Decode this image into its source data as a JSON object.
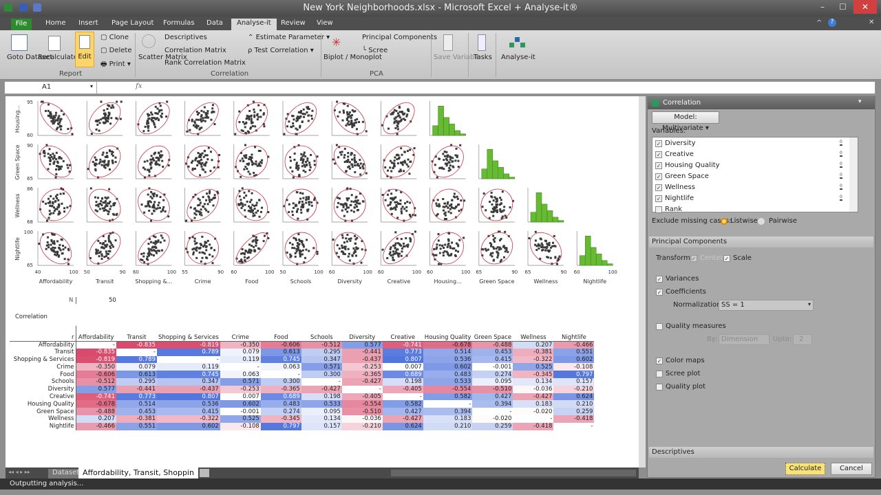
{
  "window": {
    "title": "New York Neighborhoods.xlsx - Microsoft Excel + Analyse-it®"
  },
  "tabs": [
    "File",
    "Home",
    "Insert",
    "Page Layout",
    "Formulas",
    "Data",
    "Analyse-it",
    "Review",
    "View"
  ],
  "active_tab": "Analyse-it",
  "ribbon": {
    "goto_dataset": "Goto Dataset",
    "recalculate": "Recalculate",
    "edit": "Edit",
    "clone": "Clone",
    "delete": "Delete",
    "print": "Print",
    "report_group": "Report",
    "scatter_matrix": "Scatter Matrix",
    "descriptives": "Descriptives",
    "correlation_matrix": "Correlation Matrix",
    "rank_correlation_matrix": "Rank Correlation Matrix",
    "estimate_parameter": "Estimate Parameter",
    "test_correlation": "Test Correlation",
    "correlation_group": "Correlation",
    "biplot": "Biplot / Monoplot",
    "principal_components": "Principal Components",
    "scree": "Scree",
    "pca_group": "PCA",
    "save_variable": "Save Variable",
    "tasks": "Tasks",
    "analyse_it": "Analyse-it"
  },
  "formula_bar": {
    "name_box": "A1",
    "fx": "fx",
    "value": ""
  },
  "scatter_matrix": {
    "row_labels": [
      "Housing...",
      "Green Space",
      "Wellness",
      "Nightlife"
    ],
    "row_ticks": [
      [
        "95",
        "60"
      ],
      [
        "90",
        "65"
      ],
      [
        "86",
        "68"
      ],
      [
        "100",
        "65"
      ]
    ],
    "col_labels": [
      "Affordability",
      "Transit",
      "Shopping &...",
      "Crime",
      "Food",
      "Schools",
      "Diversity",
      "Creative",
      "Housing...",
      "Green Space",
      "Wellness",
      "Nightlife"
    ],
    "col_ticks": [
      [
        "40",
        "100"
      ],
      [
        "50",
        "90"
      ],
      [
        "60",
        "100"
      ],
      [
        "55",
        "90"
      ],
      [
        "60",
        "100"
      ],
      [
        "50",
        "100"
      ],
      [
        "60",
        "100"
      ],
      [
        "60",
        "100"
      ],
      [
        "60",
        "100"
      ],
      [
        "65",
        "90"
      ],
      [
        "65",
        "90"
      ],
      [
        "60",
        "100"
      ]
    ],
    "colors": {
      "points": "#3a3a3a",
      "ellipse": "#cc3344",
      "histogram": "#66bb33"
    }
  },
  "n": {
    "label": "N",
    "value": "50"
  },
  "correlation": {
    "title": "Correlation",
    "corner": "r",
    "headers": [
      "Affordability",
      "Transit",
      "Shopping & Services",
      "Crime",
      "Food",
      "Schools",
      "Diversity",
      "Creative",
      "Housing Quality",
      "Green Space",
      "Wellness",
      "Nightlife"
    ],
    "rows": [
      {
        "label": "Affordability",
        "values": [
          "-",
          "-0.835",
          "-0.819",
          "-0.350",
          "-0.606",
          "-0.512",
          "0.577",
          "-0.741",
          "-0.678",
          "-0.488",
          "0.207",
          "-0.466"
        ]
      },
      {
        "label": "Transit",
        "values": [
          "-0.835",
          "-",
          "0.789",
          "0.079",
          "0.613",
          "0.295",
          "-0.441",
          "0.773",
          "0.514",
          "0.453",
          "-0.381",
          "0.551"
        ]
      },
      {
        "label": "Shopping & Services",
        "values": [
          "-0.819",
          "0.789",
          "-",
          "0.119",
          "0.745",
          "0.347",
          "-0.437",
          "0.807",
          "0.536",
          "0.415",
          "-0.322",
          "0.602"
        ]
      },
      {
        "label": "Crime",
        "values": [
          "-0.350",
          "0.079",
          "0.119",
          "-",
          "0.063",
          "0.571",
          "-0.253",
          "0.007",
          "0.602",
          "-0.001",
          "0.525",
          "-0.108"
        ]
      },
      {
        "label": "Food",
        "values": [
          "-0.606",
          "0.613",
          "0.745",
          "0.063",
          "-",
          "0.300",
          "-0.365",
          "0.689",
          "0.483",
          "0.274",
          "-0.345",
          "0.797"
        ]
      },
      {
        "label": "Schools",
        "values": [
          "-0.512",
          "0.295",
          "0.347",
          "0.571",
          "0.300",
          "-",
          "-0.427",
          "0.198",
          "0.533",
          "0.095",
          "0.134",
          "0.157"
        ]
      },
      {
        "label": "Diversity",
        "values": [
          "0.577",
          "-0.441",
          "-0.437",
          "-0.253",
          "-0.365",
          "-0.427",
          "-",
          "-0.405",
          "-0.554",
          "-0.510",
          "-0.036",
          "-0.210"
        ]
      },
      {
        "label": "Creative",
        "values": [
          "-0.741",
          "0.773",
          "0.807",
          "0.007",
          "0.689",
          "0.198",
          "-0.405",
          "-",
          "0.582",
          "0.427",
          "-0.427",
          "0.624"
        ]
      },
      {
        "label": "Housing Quality",
        "values": [
          "-0.678",
          "0.514",
          "0.536",
          "0.602",
          "0.483",
          "0.533",
          "-0.554",
          "0.582",
          "-",
          "0.394",
          "0.183",
          "0.210"
        ]
      },
      {
        "label": "Green Space",
        "values": [
          "-0.488",
          "0.453",
          "0.415",
          "-0.001",
          "0.274",
          "0.095",
          "-0.510",
          "0.427",
          "0.394",
          "-",
          "-0.020",
          "0.259"
        ]
      },
      {
        "label": "Wellness",
        "values": [
          "0.207",
          "-0.381",
          "-0.322",
          "0.525",
          "-0.345",
          "0.134",
          "-0.036",
          "-0.427",
          "0.183",
          "-0.020",
          "-",
          "-0.418"
        ]
      },
      {
        "label": "Nightlife",
        "values": [
          "-0.466",
          "0.551",
          "0.602",
          "-0.108",
          "0.797",
          "0.157",
          "-0.210",
          "0.624",
          "0.210",
          "0.259",
          "-0.418",
          "-"
        ]
      }
    ],
    "colors": {
      "negative": "#d9476a",
      "positive": "#4a6fdc"
    }
  },
  "sheet_tabs": {
    "tabs": [
      "Dataset",
      "Affordability, Transit, Shoppin"
    ],
    "active": "Affordability, Transit, Shoppin"
  },
  "status": "Outputting analysis...",
  "panel": {
    "title": "Correlation",
    "model": "Model: Multivariate",
    "variables_label": "Variables:",
    "variables": [
      {
        "name": "Diversity",
        "checked": true
      },
      {
        "name": "Creative",
        "checked": true
      },
      {
        "name": "Housing Quality",
        "checked": true
      },
      {
        "name": "Green Space",
        "checked": true
      },
      {
        "name": "Wellness",
        "checked": true
      },
      {
        "name": "Nightlife",
        "checked": true
      },
      {
        "name": "Rank",
        "checked": false
      }
    ],
    "exclude_label": "Exclude missing cases:",
    "listwise": "Listwise",
    "pairwise": "Pairwise",
    "exclude_selected": "Listwise",
    "pc_section": "Principal Components",
    "transform_label": "Transform:",
    "center": "Center",
    "scale": "Scale",
    "variances": "Variances",
    "coefficients": "Coefficients",
    "normalization_label": "Normalization:",
    "normalization_value": "SS = 1",
    "quality_measures": "Quality measures",
    "by_label": "By:",
    "by_value": "Dimension",
    "upto_label": "Upto:",
    "upto_value": "2",
    "color_maps": "Color maps",
    "scree_plot": "Scree plot",
    "quality_plot": "Quality plot",
    "descriptives_section": "Descriptives",
    "calculate": "Calculate",
    "cancel": "Cancel"
  }
}
